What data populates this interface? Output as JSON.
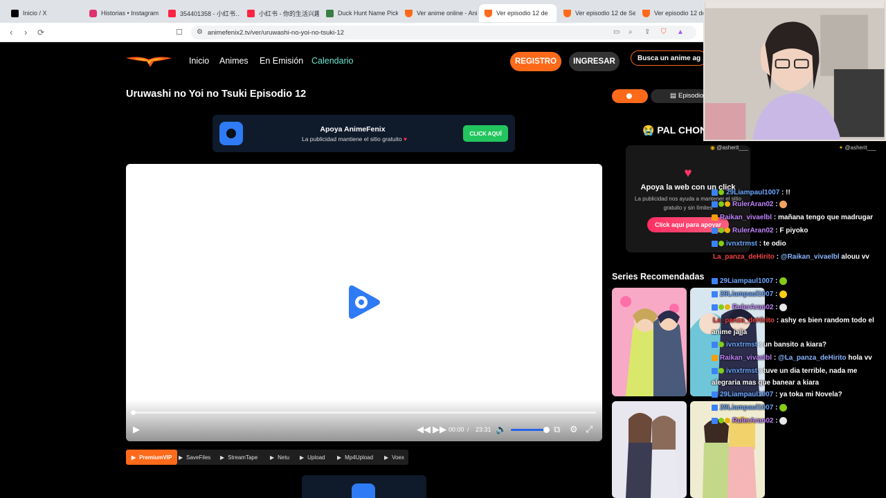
{
  "browser": {
    "tabs": [
      {
        "title": "Inicio / X",
        "color": "#000000"
      },
      {
        "title": "Historias • Instagram",
        "color": "#e1306c"
      },
      {
        "title": "354401358 - 小红书…",
        "color": "#ff2442"
      },
      {
        "title": "小红书 - 你的生活兴趣",
        "color": "#ff2442"
      },
      {
        "title": "Duck Hunt Name Picker",
        "color": "#3a7d44"
      },
      {
        "title": "Ver anime online - Ani",
        "color": "#ff6a1a"
      },
      {
        "title": "Ver episodio 12 de",
        "color": "#ff6a1a"
      },
      {
        "title": "Ver episodio 12 de Se",
        "color": "#ff6a1a"
      },
      {
        "title": "Ver episodio 12 de K",
        "color": "#ff6a1a"
      }
    ],
    "active_tab_index": 6,
    "url": "animefenix2.tv/ver/uruwashi-no-yoi-no-tsuki-12"
  },
  "site": {
    "nav": [
      "Inicio",
      "Animes",
      "En Emisión",
      "Calendario"
    ],
    "nav_active": "Calendario",
    "register": "REGISTRO",
    "login": "INGRESAR",
    "search_placeholder": "Busca un anime ag"
  },
  "episode_title": "Uruwashi no Yoi no Tsuki Episodio 12",
  "banner": {
    "title": "Apoya AnimeFenix",
    "subtitle": "La publicidad mantiene el sitio gratuito",
    "heart": "♥",
    "cta": "CLICK AQUÍ"
  },
  "player": {
    "current_time": "00:00",
    "separator": "/",
    "duration": "23:31",
    "volume": 1.0,
    "progress": 0.0
  },
  "servers": [
    "PremiumVIP",
    "SaveFiles",
    "StreamTape",
    "Netu",
    "Upload",
    "Mp4Upload",
    "Voex"
  ],
  "servers_active": "PremiumVIP",
  "sidebar": {
    "episode_pill": "Episodio",
    "section_title": "😭 PAL CHON",
    "support": {
      "title": "Apoya la web con un click",
      "text": "La publicidad nos ayuda a mantener el sitio gratuito y sin límites",
      "cta": "Click aquí para apoyar"
    },
    "series_heading": "Series Recomendadas"
  },
  "chat": {
    "tag_left": "@asherit___",
    "tag_right": "@asherit___",
    "messages": [
      {
        "user": "29Liampaul1007",
        "color": "#6ea8ff",
        "text": "!!",
        "badges": [
          "blue",
          "green"
        ]
      },
      {
        "user": "RulerAran02",
        "color": "#c084fc",
        "text": "",
        "badges": [
          "blue",
          "green",
          "gold"
        ],
        "emote": "#f4a261"
      },
      {
        "user": "Raikan_vivaelbl",
        "color": "#c084fc",
        "text": "mañana tengo que madrugar",
        "badges": [
          "orange"
        ]
      },
      {
        "user": "RulerAran02",
        "color": "#c084fc",
        "text": "F piyoko",
        "badges": [
          "blue",
          "green",
          "gold"
        ]
      },
      {
        "user": "ivnxtrmst",
        "color": "#6ea8ff",
        "text": "te odio",
        "badges": [
          "blue",
          "green"
        ]
      },
      {
        "user": "La_panza_deHirito",
        "color": "#ef4444",
        "text": "@Raikan_vivaelbl alouu vv",
        "badges": [],
        "mention": true
      },
      {
        "user": "29Liampaul1007",
        "color": "#6ea8ff",
        "text": "",
        "badges": [
          "blue"
        ],
        "emote": "#84cc16"
      },
      {
        "user": "29Liampaul1007",
        "color": "#6ea8ff",
        "text": "",
        "badges": [
          "blue"
        ],
        "emote": "#facc15"
      },
      {
        "user": "RulerAran02",
        "color": "#c084fc",
        "text": "",
        "badges": [
          "blue",
          "green",
          "gold"
        ],
        "emote": "#e5e7eb"
      },
      {
        "user": "La_panza_deHirito",
        "color": "#ef4444",
        "text": "ashy es bien random todo el anime jajja",
        "badges": []
      },
      {
        "user": "ivnxtrmst",
        "color": "#6ea8ff",
        "text": "un bansito a kiara?",
        "badges": [
          "blue",
          "green"
        ]
      },
      {
        "user": "Raikan_vivaelbl",
        "color": "#c084fc",
        "text": "@La_panza_deHirito hola vv",
        "badges": [
          "orange"
        ],
        "mention": true
      },
      {
        "user": "ivnxtrmst",
        "color": "#6ea8ff",
        "text": "tuve un dia terrible, nada me alegraria mas que banear a kiara",
        "badges": [
          "blue",
          "green"
        ]
      },
      {
        "user": "29Liampaul1007",
        "color": "#6ea8ff",
        "text": "ya toka mi Novela?",
        "badges": [
          "blue"
        ]
      },
      {
        "user": "29Liampaul1007",
        "color": "#6ea8ff",
        "text": "",
        "badges": [
          "blue"
        ],
        "emote": "#84cc16"
      },
      {
        "user": "RulerAran02",
        "color": "#c084fc",
        "text": "",
        "badges": [
          "blue",
          "green",
          "gold"
        ],
        "emote": "#e5e7eb"
      }
    ]
  },
  "colors": {
    "brand": "#ff6a1a",
    "accent": "#6ee7d2",
    "support_pink": "#ff2e63",
    "play_blue": "#2f7bf5"
  },
  "icons": [
    "back-icon",
    "forward-icon",
    "reload-icon",
    "bookmark-icon",
    "tune-icon",
    "play-icon",
    "rewind-icon",
    "fast-forward-icon",
    "volume-icon",
    "pip-icon",
    "settings-icon",
    "fullscreen-icon",
    "heart-icon",
    "episode-list-icon"
  ]
}
